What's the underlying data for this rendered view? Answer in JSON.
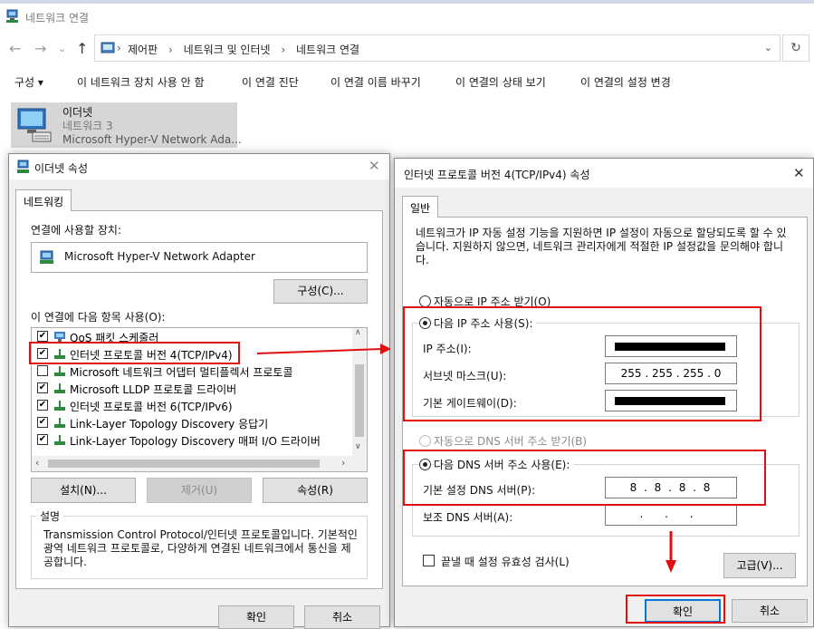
{
  "colors": {
    "annotation_red": "#e01010",
    "selected_adapter_bg": "#d6d6d6",
    "dialog_bg": "#f0f0f0"
  },
  "explorer": {
    "window_title": "네트워크 연결",
    "breadcrumbs": [
      "제어판",
      "네트워크 및 인터넷",
      "네트워크 연결"
    ],
    "commands": [
      "구성 ▾",
      "이 네트워크 장치 사용 안 함",
      "이 연결 진단",
      "이 연결 이름 바꾸기",
      "이 연결의 상태 보기",
      "이 연결의 설정 변경"
    ],
    "adapter": {
      "name": "이더넷",
      "network": "네트워크 3",
      "device": "Microsoft Hyper-V Network Ada..."
    }
  },
  "props_dialog": {
    "title": "이더넷 속성",
    "tab": "네트워킹",
    "connect_using_label": "연결에 사용할 장치:",
    "adapter_name": "Microsoft Hyper-V Network Adapter",
    "configure_button": "구성(C)...",
    "items_label": "이 연결에 다음 항목 사용(O):",
    "items": [
      {
        "label": "QoS 패킷 스케줄러",
        "checked": true,
        "icon": "qos-icon"
      },
      {
        "label": "인터넷 프로토콜 버전 4(TCP/IPv4)",
        "checked": true,
        "icon": "protocol-icon"
      },
      {
        "label": "Microsoft 네트워크 어댑터 멀티플렉서 프로토콜",
        "checked": false,
        "icon": "protocol-icon"
      },
      {
        "label": "Microsoft LLDP 프로토콜 드라이버",
        "checked": true,
        "icon": "protocol-icon"
      },
      {
        "label": "인터넷 프로토콜 버전 6(TCP/IPv6)",
        "checked": true,
        "icon": "protocol-icon"
      },
      {
        "label": "Link-Layer Topology Discovery 응답기",
        "checked": true,
        "icon": "protocol-icon"
      },
      {
        "label": "Link-Layer Topology Discovery 매퍼 I/O 드라이버",
        "checked": true,
        "icon": "protocol-icon"
      }
    ],
    "install_button": "설치(N)...",
    "uninstall_button": "제거(U)",
    "properties_button": "속성(R)",
    "description_label": "설명",
    "description_text": "Transmission Control Protocol/인터넷 프로토콜입니다. 기본적인 광역 네트워크 프로토콜로, 다양하게 연결된 네트워크에서 통신을 제공합니다.",
    "ok_button": "확인",
    "cancel_button": "취소"
  },
  "ipv4_dialog": {
    "title": "인터넷 프로토콜 버전 4(TCP/IPv4) 속성",
    "tab": "일반",
    "info_text": "네트워크가 IP 자동 설정 기능을 지원하면 IP 설정이 자동으로 할당되도록 할 수 있습니다. 지원하지 않으면, 네트워크 관리자에게 적절한 IP 설정값을 문의해야 합니다.",
    "auto_ip_label": "자동으로 IP 주소 받기(O)",
    "manual_ip_label": "다음 IP 주소 사용(S):",
    "ip_address_label": "IP 주소(I):",
    "subnet_label": "서브넷 마스크(U):",
    "subnet_value": "255 . 255 . 255 . 0",
    "gateway_label": "기본 게이트웨이(D):",
    "auto_dns_label": "자동으로 DNS 서버 주소 받기(B)",
    "manual_dns_label": "다음 DNS 서버 주소 사용(E):",
    "preferred_dns_label": "기본 설정 DNS 서버(P):",
    "preferred_dns_value": "8 . 8 . 8 . 8",
    "alternate_dns_label": "보조 DNS 서버(A):",
    "alternate_dns_value": ". . .",
    "validate_label": "끝낼 때 설정 유효성 검사(L)",
    "advanced_button": "고급(V)...",
    "ok_button": "확인",
    "cancel_button": "취소"
  }
}
